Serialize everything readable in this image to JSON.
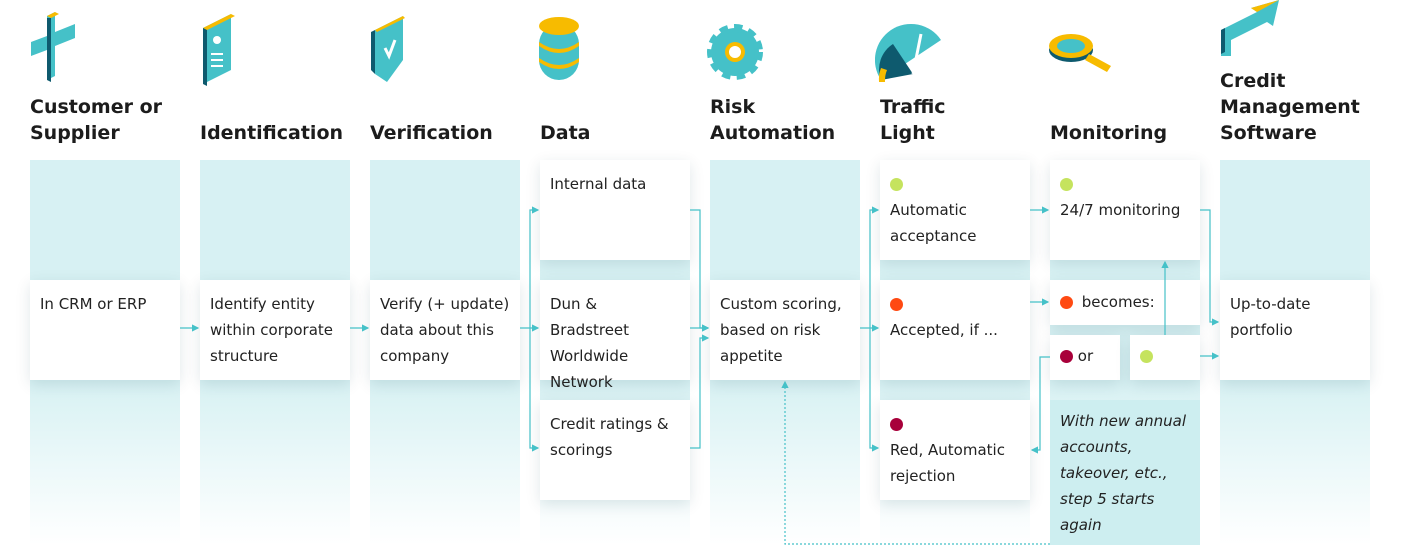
{
  "colors": {
    "teal": "#45c1c8",
    "dark_teal": "#0e5a6e",
    "yellow": "#f7bb00",
    "green": "#c5e35e",
    "orange": "#ff4a12",
    "red": "#a8003a"
  },
  "steps": [
    {
      "title": "Customer or Supplier",
      "icon": "plus-icon"
    },
    {
      "title": "Identification",
      "icon": "id-card-icon"
    },
    {
      "title": "Verification",
      "icon": "shield-check-icon"
    },
    {
      "title": "Data",
      "icon": "database-icon"
    },
    {
      "title": "Risk Automation",
      "icon": "gear-icon"
    },
    {
      "title": "Traffic Light",
      "icon": "gauge-icon"
    },
    {
      "title": "Monitoring",
      "icon": "magnifier-icon"
    },
    {
      "title": "Credit Management Software",
      "icon": "arrow-icon"
    }
  ],
  "boxes": {
    "crm": "In CRM or ERP",
    "identify": "Identify entity within corporate structure",
    "verify": "Verify (+ update) data about this company",
    "internal": "Internal data",
    "dnb": "Dun & Bradstreet Worldwide Network",
    "ratings": "Credit ratings & scorings",
    "scoring": "Custom scoring, based on risk appetite",
    "accept": "Automatic acceptance",
    "accepted_if": "Accepted, if ...",
    "reject": "Red, Automatic rejection",
    "monitoring": "24/7 monitoring",
    "becomes": "becomes:",
    "or": "or",
    "note": "With new annual accounts, takeover, etc., step 5 starts again",
    "portfolio": "Up-to-date portfolio"
  }
}
